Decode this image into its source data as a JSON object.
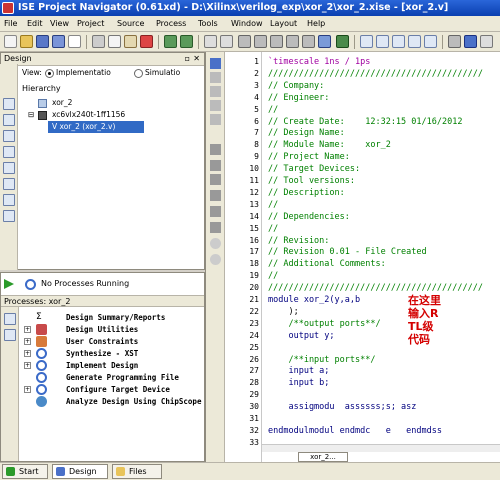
{
  "window": {
    "title": "ISE Project Navigator (0.61xd) - D:\\Xilinx\\verilog_exp\\xor_2\\xor_2.xise - [xor_2.v]"
  },
  "menu": [
    "File",
    "Edit",
    "View",
    "Project",
    "Source",
    "Process",
    "Tools",
    "Window",
    "Layout",
    "Help"
  ],
  "design_panel": {
    "header": "Design",
    "view_label": "View:",
    "view_options": [
      "Implementatio",
      "Simulatio"
    ],
    "hierarchy_label": "Hierarchy",
    "tree": [
      "xor_2",
      "xc6vlx240t-1ff1156",
      "V xor_2 (xor_2.v)"
    ]
  },
  "process_panel": {
    "status": "No Processes Running",
    "header": "Processes: xor_2",
    "items": [
      "Design Summary/Reports",
      "Design Utilities",
      "User Constraints",
      "Synthesize - XST",
      "Implement Design",
      "Generate Programming File",
      "Configure Target Device",
      "Analyze Design Using ChipScope"
    ]
  },
  "bottom_tabs": [
    "Start",
    "Design",
    "Files"
  ],
  "editor": {
    "line_numbers": [
      "1",
      "2",
      "3",
      "4",
      "5",
      "6",
      "7",
      "8",
      "9",
      "10",
      "11",
      "12",
      "13",
      "14",
      "15",
      "16",
      "17",
      "18",
      "19",
      "20",
      "21",
      "22",
      "23",
      "24",
      "25",
      "26",
      "27",
      "28",
      "29",
      "30",
      "31",
      "32",
      "33"
    ],
    "lines": [
      "`timescale 1ns / 1ps",
      "//////////////////////////////////////////",
      "// Company:",
      "// Engineer:",
      "//",
      "// Create Date:    12:32:15 01/16/2012",
      "// Design Name:",
      "// Module Name:    xor_2",
      "// Project Name:",
      "// Target Devices:",
      "// Tool versions:",
      "// Description:",
      "//",
      "// Dependencies:",
      "//",
      "// Revision:",
      "// Revision 0.01 - File Created",
      "// Additional Comments:",
      "//",
      "//////////////////////////////////////////",
      "module xor_2(y,a,b",
      "    );",
      "    /**output ports**/",
      "    output y;",
      "",
      "    /**input ports**/",
      "    input a;",
      "    input b;",
      "",
      "    assigmodu  assssss;s; asz",
      "",
      "endmodulmodul endmdc   e   endmdss",
      ""
    ],
    "annotation": "在这里输入RTL级代码",
    "tab_label": "xor_2..."
  }
}
